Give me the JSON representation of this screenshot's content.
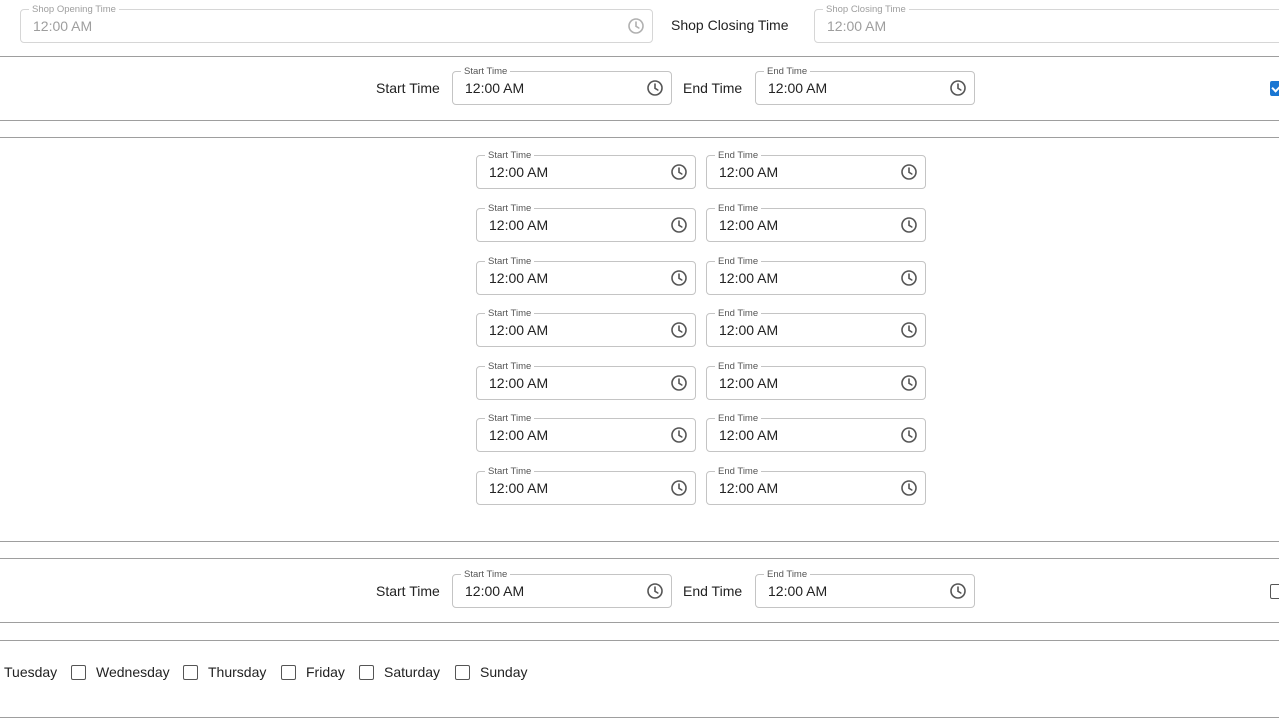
{
  "shop_hours": {
    "opening_legend": "Shop Opening Time",
    "opening_value": "12:00 AM",
    "closing_label": "Shop Closing Time",
    "closing_legend": "Shop Closing Time",
    "closing_value": "12:00 AM"
  },
  "row1": {
    "start_label": "Start Time",
    "start_legend": "Start Time",
    "start_value": "12:00 AM",
    "end_label": "End Time",
    "end_legend": "End Time",
    "end_value": "12:00 AM",
    "checked": true
  },
  "slots": [
    {
      "start_legend": "Start Time",
      "start_value": "12:00 AM",
      "end_legend": "End Time",
      "end_value": "12:00 AM"
    },
    {
      "start_legend": "Start Time",
      "start_value": "12:00 AM",
      "end_legend": "End Time",
      "end_value": "12:00 AM"
    },
    {
      "start_legend": "Start Time",
      "start_value": "12:00 AM",
      "end_legend": "End Time",
      "end_value": "12:00 AM"
    },
    {
      "start_legend": "Start Time",
      "start_value": "12:00 AM",
      "end_legend": "End Time",
      "end_value": "12:00 AM"
    },
    {
      "start_legend": "Start Time",
      "start_value": "12:00 AM",
      "end_legend": "End Time",
      "end_value": "12:00 AM"
    },
    {
      "start_legend": "Start Time",
      "start_value": "12:00 AM",
      "end_legend": "End Time",
      "end_value": "12:00 AM"
    },
    {
      "start_legend": "Start Time",
      "start_value": "12:00 AM",
      "end_legend": "End Time",
      "end_value": "12:00 AM"
    }
  ],
  "row2": {
    "start_label": "Start Time",
    "start_legend": "Start Time",
    "start_value": "12:00 AM",
    "end_label": "End Time",
    "end_legend": "End Time",
    "end_value": "12:00 AM",
    "checked": false
  },
  "days": {
    "tuesday": "Tuesday",
    "wednesday": "Wednesday",
    "thursday": "Thursday",
    "friday": "Friday",
    "saturday": "Saturday",
    "sunday": "Sunday"
  },
  "colors": {
    "accent": "#1976d2",
    "divider": "#9e9e9e",
    "field_border": "#c4c4c4"
  }
}
